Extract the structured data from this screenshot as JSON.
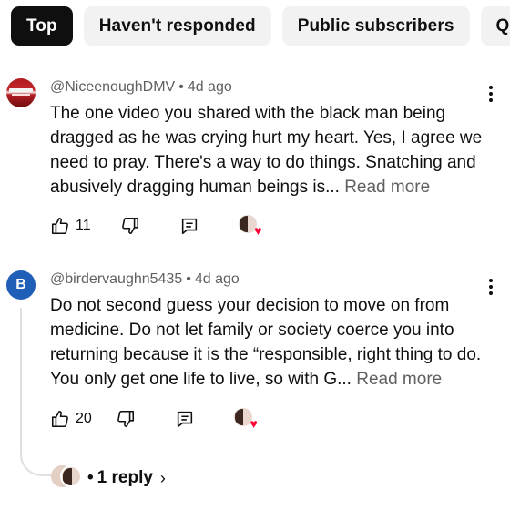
{
  "filters": [
    {
      "label": "Top",
      "active": true
    },
    {
      "label": "Haven't responded",
      "active": false
    },
    {
      "label": "Public subscribers",
      "active": false
    },
    {
      "label": "Qu",
      "active": false
    }
  ],
  "comments": [
    {
      "author": "@NiceenoughDMV",
      "time": "4d ago",
      "text": "The one video you shared with the black man being dragged as he was crying hurt my heart. Yes, I agree we need to pray. There's a way to do things. Snatching and abusively dragging human beings is...",
      "read_more": "Read more",
      "likes": "11"
    },
    {
      "author": "@birdervaughn5435",
      "avatar_letter": "B",
      "time": "4d ago",
      "text": "Do not second guess your decision to move on from medicine. Do not let family or society coerce you into returning because it is the “responsible, right thing to do. You only get one life to live, so with G...",
      "read_more": "Read more",
      "likes": "20"
    }
  ],
  "replies": {
    "label": "1 reply"
  },
  "icons": {
    "like": "thumbs-up-icon",
    "dislike": "thumbs-down-icon",
    "reply": "reply-icon",
    "more": "more-vert-icon",
    "creator_heart": "heart-icon",
    "chevron": "chevron-right-icon"
  },
  "colors": {
    "heart": "#ff0033",
    "chip_active": "#0f0f0f",
    "avatar_letter_bg": "#1f5fb8"
  }
}
